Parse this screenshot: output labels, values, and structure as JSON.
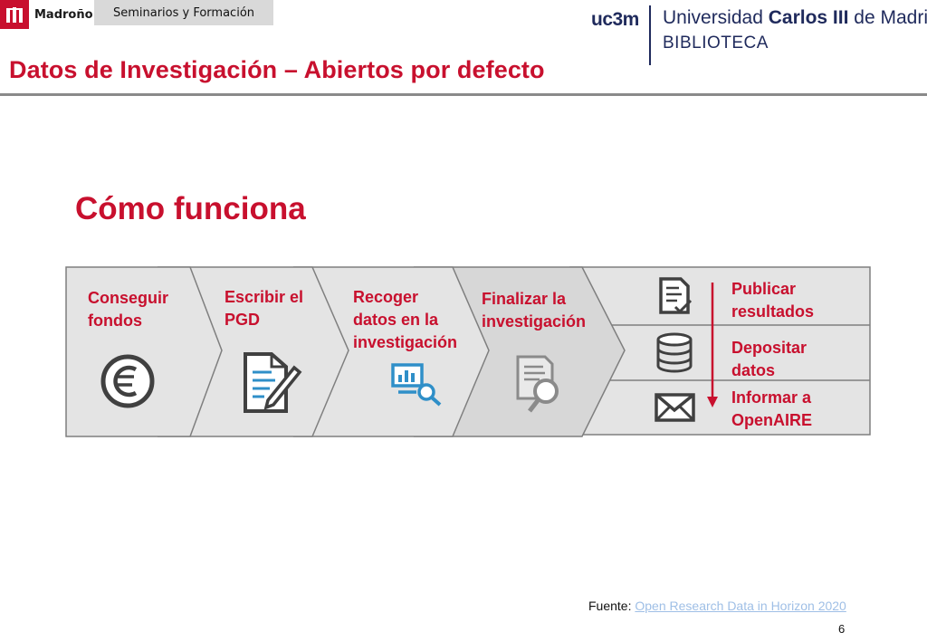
{
  "header": {
    "brand_name": "Madroño",
    "tab_label": "Seminarios y Formación"
  },
  "university": {
    "mark": "uc3m",
    "name_prefix": "Universidad",
    "name_bold": "Carlos III",
    "name_suffix": "de Madrid",
    "library": "BIBLIOTECA"
  },
  "title": "Datos de Investigación – Abiertos por defecto",
  "section_heading": "Cómo funciona",
  "steps": [
    {
      "label": "Conseguir\nfondos",
      "icon": "euro-icon"
    },
    {
      "label": "Escribir el\nPGD",
      "icon": "document-edit-icon"
    },
    {
      "label": "Recoger\ndatos en la\ninvestigación",
      "icon": "data-search-icon"
    },
    {
      "label": "Finalizar la\ninvestigación",
      "icon": "document-search-icon"
    }
  ],
  "publication": [
    {
      "label": "Publicar\nresultados",
      "icon": "document-check-icon"
    },
    {
      "label": "Depositar\ndatos",
      "icon": "database-icon"
    },
    {
      "label": "Informar a\nOpenAIRE",
      "icon": "envelope-icon"
    }
  ],
  "footer": {
    "source_prefix": "Fuente:",
    "source_link": "Open Research Data in Horizon 2020",
    "page_number": "6"
  },
  "colors": {
    "accent": "#c8102e",
    "chevron_fill": "#e4e4e4",
    "chevron_stroke": "#7f7f7f",
    "icon_dark": "#404040",
    "icon_blue": "#2f8fc8",
    "link": "#9fbfe6"
  }
}
